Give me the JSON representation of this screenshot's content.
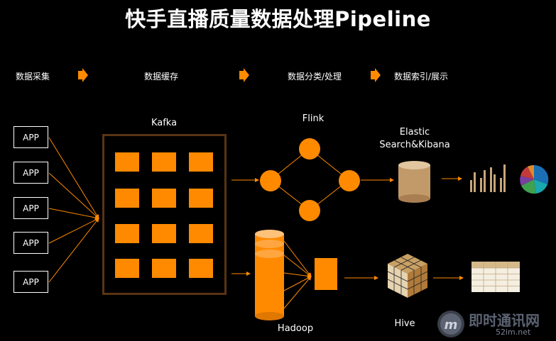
{
  "title": "快手直播质量数据处理Pipeline",
  "stages": [
    "数据采集",
    "数据缓存",
    "数据分类/处理",
    "数据索引/展示"
  ],
  "apps": [
    "APP",
    "APP",
    "APP",
    "APP",
    "APP"
  ],
  "labels": {
    "kafka": "Kafka",
    "flink": "Flink",
    "elastic_line1": "Elastic",
    "elastic_line2": "Search&Kibana",
    "hadoop": "Hadoop",
    "hive": "Hive"
  },
  "watermark": {
    "name": "即时通讯网",
    "url": "52im.net"
  },
  "colors": {
    "accent": "#ff8a00",
    "background": "#000000",
    "text": "#ffffff",
    "kafka_border": "#5a3413"
  }
}
